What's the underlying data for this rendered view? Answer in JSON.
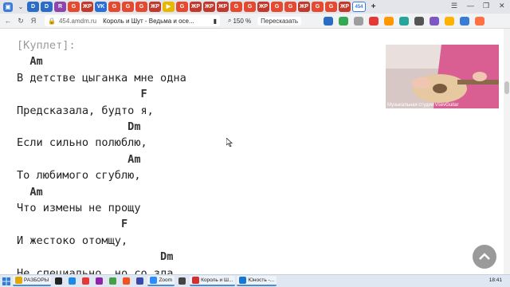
{
  "browser": {
    "tabs": [
      {
        "icon": "D",
        "color": "#2b6cc4"
      },
      {
        "icon": "D",
        "color": "#2b6cc4"
      },
      {
        "icon": "R",
        "color": "#8e44ad"
      },
      {
        "icon": "G",
        "color": "#e34a2f"
      },
      {
        "icon": "ЖР",
        "color": "#c0392b"
      },
      {
        "icon": "VK",
        "color": "#2a6fd6"
      },
      {
        "icon": "G",
        "color": "#e34a2f"
      },
      {
        "icon": "G",
        "color": "#e34a2f"
      },
      {
        "icon": "G",
        "color": "#e34a2f"
      },
      {
        "icon": "ЖР",
        "color": "#c0392b"
      },
      {
        "icon": "▶",
        "color": "#e6b800"
      },
      {
        "icon": "G",
        "color": "#e34a2f"
      },
      {
        "icon": "ЖР",
        "color": "#c0392b"
      },
      {
        "icon": "ЖР",
        "color": "#c0392b"
      },
      {
        "icon": "ЖР",
        "color": "#c0392b"
      },
      {
        "icon": "G",
        "color": "#e34a2f"
      },
      {
        "icon": "G",
        "color": "#e34a2f"
      },
      {
        "icon": "ЖР",
        "color": "#c0392b"
      },
      {
        "icon": "G",
        "color": "#e34a2f"
      },
      {
        "icon": "G",
        "color": "#e34a2f"
      },
      {
        "icon": "ЖР",
        "color": "#c0392b"
      },
      {
        "icon": "G",
        "color": "#e34a2f"
      },
      {
        "icon": "G",
        "color": "#e34a2f"
      },
      {
        "icon": "ЖР",
        "color": "#c0392b"
      }
    ],
    "active_tab_icon": "454",
    "address": {
      "domain": "454.amdm.ru",
      "title": "Король и Шут - Ведьма и осе..."
    },
    "zoom": "150 %",
    "translate_label": "Пересказать"
  },
  "lyrics": [
    {
      "text": "[Куплет]:",
      "kind": "section"
    },
    {
      "text": "  Am",
      "kind": "chord"
    },
    {
      "text": "В детстве цыганка мне одна",
      "kind": "line"
    },
    {
      "text": "                   F",
      "kind": "chord"
    },
    {
      "text": "Предсказала, будто я,",
      "kind": "line"
    },
    {
      "text": "                 Dm",
      "kind": "chord"
    },
    {
      "text": "Если сильно полюблю,",
      "kind": "line"
    },
    {
      "text": "                 Am",
      "kind": "chord"
    },
    {
      "text": "То любимого сгублю,",
      "kind": "line"
    },
    {
      "text": "  Am",
      "kind": "chord"
    },
    {
      "text": "Что измены не прощу",
      "kind": "line"
    },
    {
      "text": "                F",
      "kind": "chord"
    },
    {
      "text": "И жестоко отомщу,",
      "kind": "line"
    },
    {
      "text": "                      Dm",
      "kind": "chord"
    },
    {
      "text": "Не специально, но со зла",
      "kind": "line"
    }
  ],
  "video": {
    "caption": "Музыкальная студия VsevGuitar"
  },
  "taskbar": {
    "items": [
      {
        "label": "РАЗБОРЫ",
        "color": "#e0a800",
        "open": true
      },
      {
        "label": "",
        "color": "#222222",
        "open": false
      },
      {
        "label": "",
        "color": "#1e88e5",
        "open": false
      },
      {
        "label": "",
        "color": "#e53935",
        "open": false
      },
      {
        "label": "",
        "color": "#8e24aa",
        "open": false
      },
      {
        "label": "",
        "color": "#43a047",
        "open": false
      },
      {
        "label": "",
        "color": "#f4511e",
        "open": false
      },
      {
        "label": "",
        "color": "#3949ab",
        "open": false
      },
      {
        "label": "Zoom",
        "color": "#2d8cff",
        "open": true
      },
      {
        "label": "",
        "color": "#444444",
        "open": false
      },
      {
        "label": "Король и Ш...",
        "color": "#d32f2f",
        "open": true
      },
      {
        "label": "Юность -...",
        "color": "#1976d2",
        "open": true
      }
    ],
    "time": "18:41"
  }
}
